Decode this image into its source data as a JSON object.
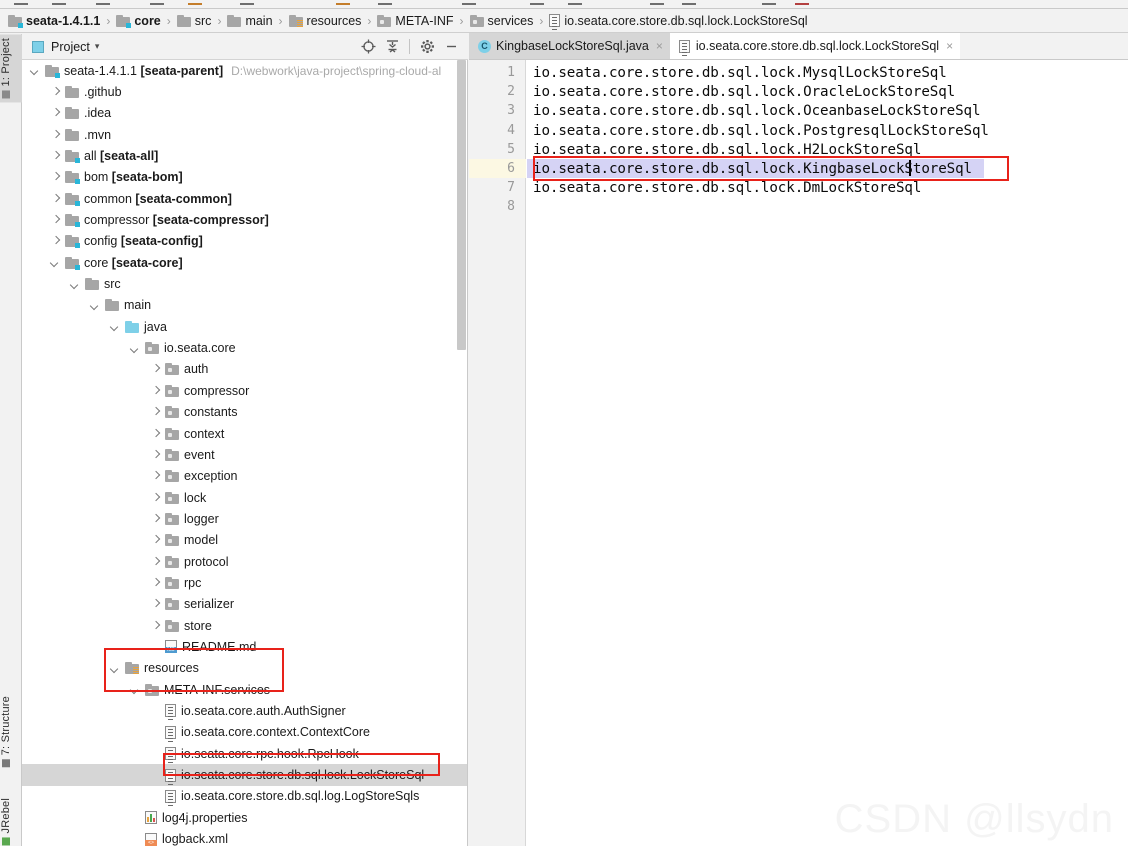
{
  "breadcrumb": {
    "items": [
      {
        "label": "seata-1.4.1.1",
        "icon": "module-folder-icon",
        "bold_part": "seata-1.4.1.1"
      },
      {
        "label": "core",
        "icon": "module-folder-icon"
      },
      {
        "label": "src",
        "icon": "folder-icon"
      },
      {
        "label": "main",
        "icon": "folder-icon"
      },
      {
        "label": "resources",
        "icon": "resources-folder-icon"
      },
      {
        "label": "META-INF",
        "icon": "package-folder-icon"
      },
      {
        "label": "services",
        "icon": "package-folder-icon"
      },
      {
        "label": "io.seata.core.store.db.sql.lock.LockStoreSql",
        "icon": "services-file-icon"
      }
    ]
  },
  "leftbar": {
    "tabs": [
      {
        "label": "1: Project",
        "active": true,
        "icon": "project-icon"
      },
      {
        "label": "7: Structure",
        "active": false,
        "icon": "structure-icon"
      },
      {
        "label": "JRebel",
        "active": false,
        "icon": "jrebel-icon"
      }
    ]
  },
  "project_panel": {
    "title": "Project",
    "caret": "▾",
    "tools": [
      {
        "name": "locate-icon",
        "glyph": "⊕"
      },
      {
        "name": "collapse-all-icon",
        "glyph": "≡"
      },
      {
        "name": "settings-gear-icon",
        "glyph": "⚙"
      },
      {
        "name": "hide-icon",
        "glyph": "−"
      }
    ],
    "tree": [
      {
        "label": "seata-1.4.1.1",
        "bold": "[seata-parent]",
        "path": "D:\\webwork\\java-project\\spring-cloud-al",
        "indent": 0,
        "state": "open",
        "icon": "module-folder-icon"
      },
      {
        "label": ".github",
        "indent": 1,
        "state": "closed",
        "icon": "folder-icon"
      },
      {
        "label": ".idea",
        "indent": 1,
        "state": "closed",
        "icon": "folder-icon"
      },
      {
        "label": ".mvn",
        "indent": 1,
        "state": "closed",
        "icon": "folder-icon"
      },
      {
        "label": "all",
        "bold": "[seata-all]",
        "indent": 1,
        "state": "closed",
        "icon": "module-folder-icon"
      },
      {
        "label": "bom",
        "bold": "[seata-bom]",
        "indent": 1,
        "state": "closed",
        "icon": "module-folder-icon"
      },
      {
        "label": "common",
        "bold": "[seata-common]",
        "indent": 1,
        "state": "closed",
        "icon": "module-folder-icon"
      },
      {
        "label": "compressor",
        "bold": "[seata-compressor]",
        "indent": 1,
        "state": "closed",
        "icon": "module-folder-icon"
      },
      {
        "label": "config",
        "bold": "[seata-config]",
        "indent": 1,
        "state": "closed",
        "icon": "module-folder-icon"
      },
      {
        "label": "core",
        "bold": "[seata-core]",
        "indent": 1,
        "state": "open",
        "icon": "module-folder-icon"
      },
      {
        "label": "src",
        "indent": 2,
        "state": "open",
        "icon": "folder-icon"
      },
      {
        "label": "main",
        "indent": 3,
        "state": "open",
        "icon": "folder-icon"
      },
      {
        "label": "java",
        "indent": 4,
        "state": "open",
        "icon": "source-root-folder-icon"
      },
      {
        "label": "io.seata.core",
        "indent": 5,
        "state": "open",
        "icon": "package-folder-icon"
      },
      {
        "label": "auth",
        "indent": 6,
        "state": "closed",
        "icon": "package-folder-icon"
      },
      {
        "label": "compressor",
        "indent": 6,
        "state": "closed",
        "icon": "package-folder-icon"
      },
      {
        "label": "constants",
        "indent": 6,
        "state": "closed",
        "icon": "package-folder-icon"
      },
      {
        "label": "context",
        "indent": 6,
        "state": "closed",
        "icon": "package-folder-icon"
      },
      {
        "label": "event",
        "indent": 6,
        "state": "closed",
        "icon": "package-folder-icon"
      },
      {
        "label": "exception",
        "indent": 6,
        "state": "closed",
        "icon": "package-folder-icon"
      },
      {
        "label": "lock",
        "indent": 6,
        "state": "closed",
        "icon": "package-folder-icon"
      },
      {
        "label": "logger",
        "indent": 6,
        "state": "closed",
        "icon": "package-folder-icon"
      },
      {
        "label": "model",
        "indent": 6,
        "state": "closed",
        "icon": "package-folder-icon"
      },
      {
        "label": "protocol",
        "indent": 6,
        "state": "closed",
        "icon": "package-folder-icon"
      },
      {
        "label": "rpc",
        "indent": 6,
        "state": "closed",
        "icon": "package-folder-icon"
      },
      {
        "label": "serializer",
        "indent": 6,
        "state": "closed",
        "icon": "package-folder-icon"
      },
      {
        "label": "store",
        "indent": 6,
        "state": "closed",
        "icon": "package-folder-icon"
      },
      {
        "label": "README.md",
        "indent": 6,
        "state": "leaf",
        "icon": "markdown-file-icon"
      },
      {
        "label": "resources",
        "indent": 4,
        "state": "open",
        "icon": "resources-folder-icon"
      },
      {
        "label": "META-INF.services",
        "indent": 5,
        "state": "open",
        "icon": "package-folder-icon"
      },
      {
        "label": "io.seata.core.auth.AuthSigner",
        "indent": 6,
        "state": "leaf",
        "icon": "services-file-icon"
      },
      {
        "label": "io.seata.core.context.ContextCore",
        "indent": 6,
        "state": "leaf",
        "icon": "services-file-icon"
      },
      {
        "label": "io.seata.core.rpc.hook.RpcHook",
        "indent": 6,
        "state": "leaf",
        "icon": "services-file-icon"
      },
      {
        "label": "io.seata.core.store.db.sql.lock.LockStoreSql",
        "indent": 6,
        "state": "leaf",
        "icon": "services-file-icon",
        "selected": true
      },
      {
        "label": "io.seata.core.store.db.sql.log.LogStoreSqls",
        "indent": 6,
        "state": "leaf",
        "icon": "services-file-icon"
      },
      {
        "label": "log4j.properties",
        "indent": 5,
        "state": "leaf",
        "icon": "properties-file-icon"
      },
      {
        "label": "logback.xml",
        "indent": 5,
        "state": "leaf",
        "icon": "xml-file-icon"
      }
    ]
  },
  "editor": {
    "tabs": [
      {
        "label": "KingbaseLockStoreSql.java",
        "icon": "java-class-icon",
        "active": false,
        "close": "×"
      },
      {
        "label": "io.seata.core.store.db.sql.lock.LockStoreSql",
        "icon": "services-file-icon",
        "active": true,
        "close": "×"
      }
    ],
    "lines": [
      {
        "no": "1",
        "text": "io.seata.core.store.db.sql.lock.MysqlLockStoreSql"
      },
      {
        "no": "2",
        "text": "io.seata.core.store.db.sql.lock.OracleLockStoreSql"
      },
      {
        "no": "3",
        "text": "io.seata.core.store.db.sql.lock.OceanbaseLockStoreSql"
      },
      {
        "no": "4",
        "text": "io.seata.core.store.db.sql.lock.PostgresqlLockStoreSql"
      },
      {
        "no": "5",
        "text": "io.seata.core.store.db.sql.lock.H2LockStoreSql"
      },
      {
        "no": "6",
        "text": "io.seata.core.store.db.sql.lock.KingbaseLockStoreSql",
        "selected": true,
        "current": true
      },
      {
        "no": "7",
        "text": "io.seata.core.store.db.sql.lock.DmLockStoreSql"
      },
      {
        "no": "8",
        "text": ""
      }
    ]
  },
  "watermark": "CSDN @llsydn",
  "colors": {
    "annotation_red": "#e8221a",
    "selection_lavender": "#d5d3f5",
    "current_line_yellow": "#fcf8e3",
    "tree_selected_gray": "#d6d6d6",
    "module_badge_cyan": "#29b6d8"
  }
}
